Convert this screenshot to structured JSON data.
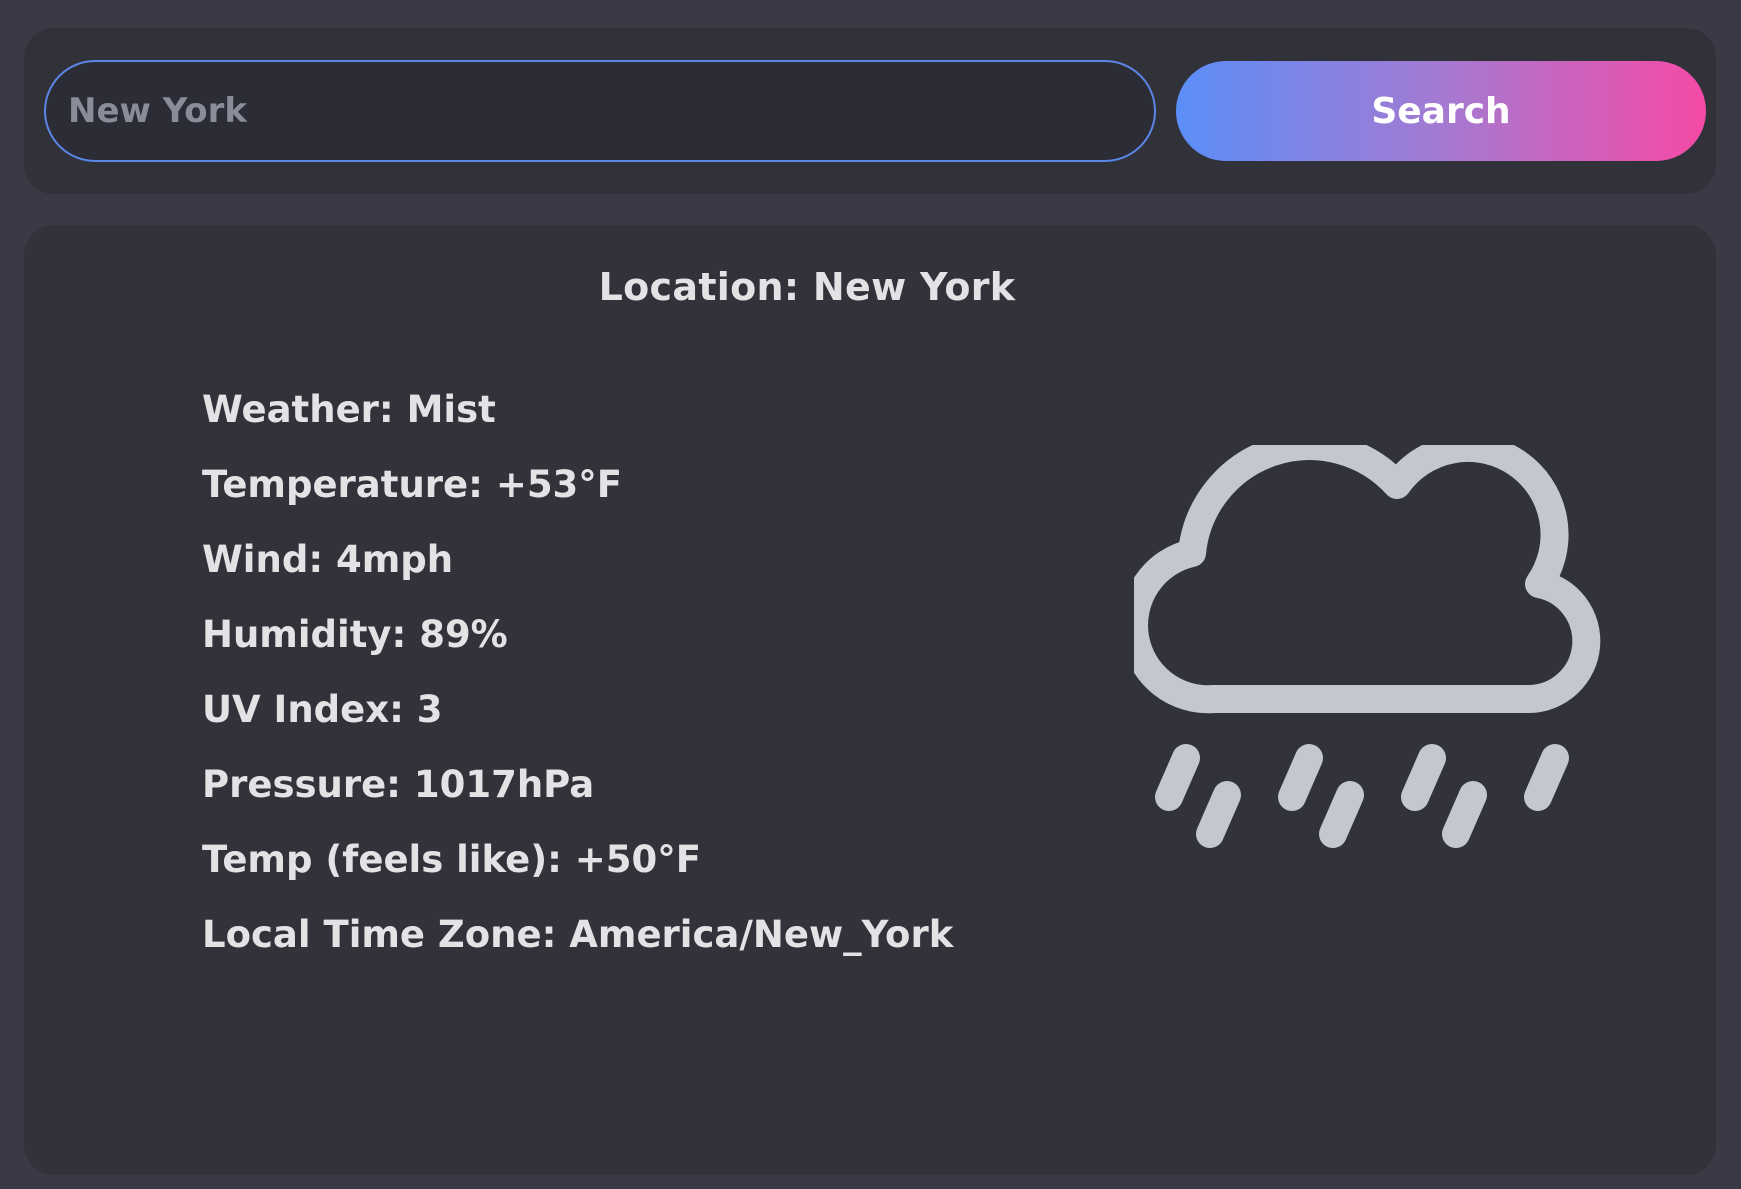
{
  "search": {
    "value": "New York",
    "button_label": "Search",
    "button_gradient": [
      "#5b8ef8",
      "#f54aa6"
    ]
  },
  "result": {
    "location": "Location: New York",
    "details": [
      "Weather: Mist",
      "Temperature: +53°F",
      "Wind: 4mph",
      "Humidity: 89%",
      "UV Index: 3",
      "Pressure: 1017hPa",
      "Temp (feels like): +50°F",
      "Local Time Zone: America/New_York"
    ],
    "icon": "cloud-rain-icon",
    "icon_color": "#c4c7ce"
  },
  "colors": {
    "background": "#3a3a46",
    "panel": "#32323a",
    "text": "#e3e3e6",
    "input_border": "#5a86e6"
  }
}
